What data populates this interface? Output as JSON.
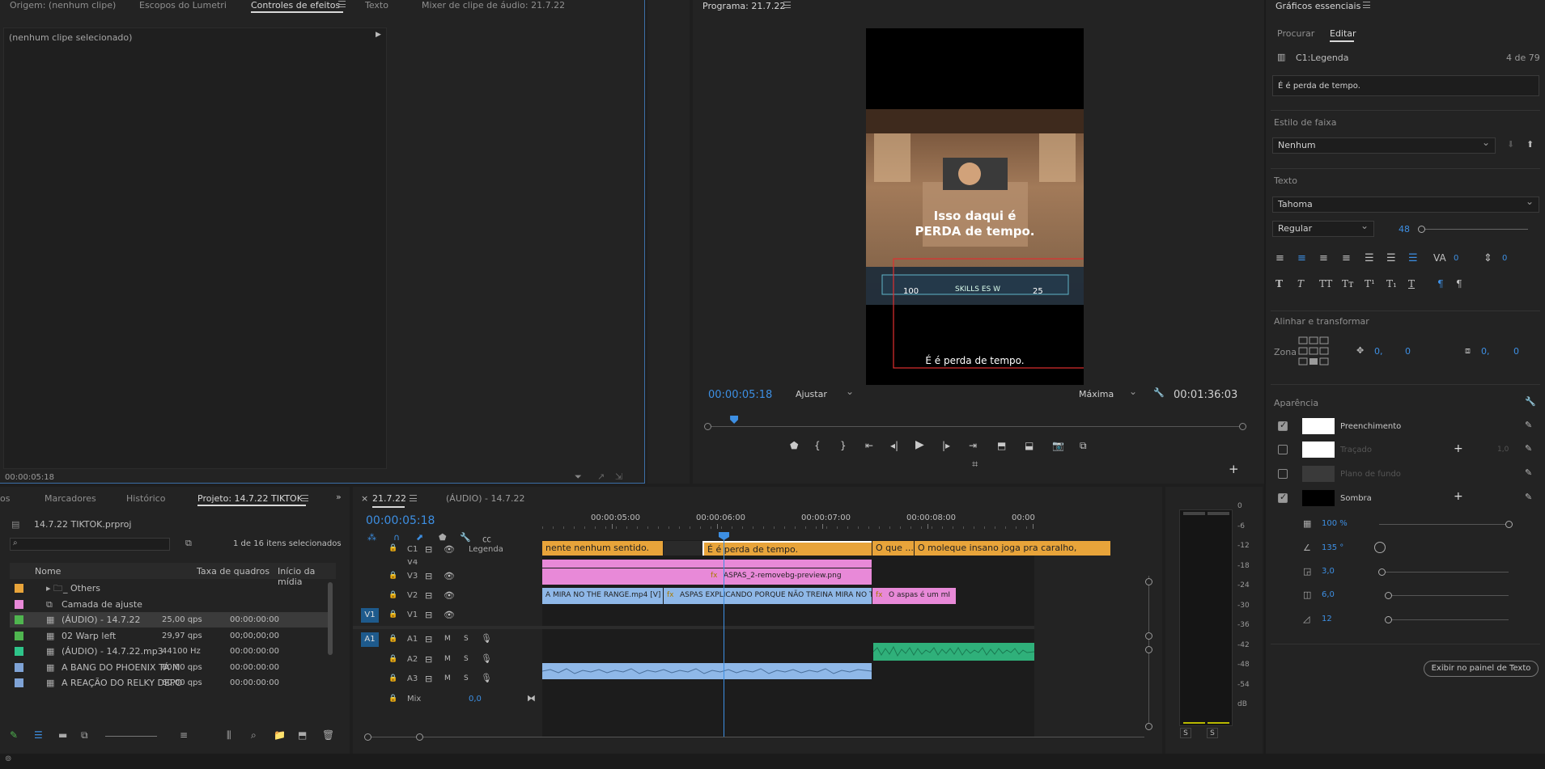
{
  "source_panel": {
    "tabs": [
      "Origem: (nenhum clipe)",
      "Escopos do Lumetri",
      "Controles de efeitos",
      "Texto",
      "Mixer de clipe de áudio: 21.7.22"
    ],
    "no_clip": "(nenhum clipe selecionado)",
    "timecode": "00:00:05:18"
  },
  "program": {
    "title": "Programa: 21.7.22",
    "timecode": "00:00:05:18",
    "fit": "Ajustar",
    "quality": "Máxima",
    "duration": "00:01:36:03",
    "frame_text_1": "Isso daqui é",
    "frame_text_2": "PERDA de tempo.",
    "caption": "É é perda de tempo.",
    "hud_left": "100",
    "hud_mid": "SKILLS ES W",
    "hud_right": "25",
    "playhead_fraction": 0.05
  },
  "project_panel": {
    "tabs": [
      "os",
      "Marcadores",
      "Histórico",
      "Projeto: 14.7.22 TIKTOK"
    ],
    "file": "14.7.22 TIKTOK.prproj",
    "count": "1 de 16 itens selecionados",
    "columns": [
      "Nome",
      "Taxa de quadros",
      "Início da mídia"
    ],
    "rows": [
      {
        "name": "_ Others",
        "rate": "",
        "start": "",
        "color": "#e8a43a"
      },
      {
        "name": "Camada de ajuste",
        "rate": "",
        "start": "",
        "color": "#e889d8"
      },
      {
        "name": "(ÁUDIO) - 14.7.22",
        "rate": "25,00 qps",
        "start": "00:00:00:00",
        "color": "#4fb54f"
      },
      {
        "name": "02 Warp left",
        "rate": "29,97 qps",
        "start": "00;00;00;00",
        "color": "#4fb54f"
      },
      {
        "name": "(ÁUDIO) - 14.7.22.mp3",
        "rate": "44100 Hz",
        "start": "00:00:00:00",
        "color": "#2ec48a"
      },
      {
        "name": "A BANG DO PHOENIX TÁ M",
        "rate": "60,00 qps",
        "start": "00:00:00:00",
        "color": "#7fa3d6"
      },
      {
        "name": "A REAÇÃO DO RELKY DEPO",
        "rate": "60,00 qps",
        "start": "00:00:00:00",
        "color": "#7fa3d6"
      }
    ]
  },
  "timeline": {
    "tabs": [
      "21.7.22",
      "(ÁUDIO) - 14.7.22"
    ],
    "timecode": "00:00:05:18",
    "ruler": [
      "00:00:05:00",
      "00:00:06:00",
      "00:00:07:00",
      "00:00:08:00",
      "00:00"
    ],
    "caption_track_label": "Legenda",
    "tracks": {
      "c1": "C1",
      "v4": "V4",
      "v3": "V3",
      "v2": "V2",
      "v1": "V1",
      "a1": "A1",
      "a2": "A2",
      "a3": "A3",
      "mix": "Mix",
      "mix_value": "0,0",
      "v1_src": "V1",
      "a1_src": "A1",
      "m": "M",
      "s": "S"
    },
    "captions": [
      "nente nenhum sentido.",
      "É é perda de tempo.",
      "O que ...",
      "O moleque insano joga pra caralho,"
    ],
    "clips": {
      "v3": "ASPAS_2-removebg-preview.png",
      "v2a": "A MIRA NO THE RANGE.mp4 [V]",
      "v2b": "ASPAS EXPLICANDO PORQUE NÃO TREINA MIRA NO TH",
      "v2c": "O aspas é um mI",
      "fx": "fx"
    }
  },
  "meter": {
    "scale": [
      "0",
      "-6",
      "-12",
      "-18",
      "-24",
      "-30",
      "-36",
      "-42",
      "-48",
      "-54",
      "dB"
    ],
    "solo": "S"
  },
  "essential_graphics": {
    "title": "Gráficos essenciais",
    "tabs": [
      "Procurar",
      "Editar"
    ],
    "layer": "C1:Legenda",
    "layer_count": "4 de 79",
    "text_value": "É é perda de tempo.",
    "track_style_label": "Estilo de faixa",
    "track_style": "Nenhum",
    "text_label": "Texto",
    "font": "Tahoma",
    "weight": "Regular",
    "size": "48",
    "tracking": "0",
    "leading": "0",
    "align_label": "Alinhar e transformar",
    "zone_label": "Zona",
    "pos_x": "0,",
    "pos_y": "0",
    "scale_x": "0,",
    "scale_y": "0",
    "appearance_label": "Aparência",
    "fill": "Preenchimento",
    "stroke": "Traçado",
    "stroke_value": "1,0",
    "bg": "Plano de fundo",
    "shadow": "Sombra",
    "opacity": "100 %",
    "angle": "135 °",
    "distance": "3,0",
    "size2": "6,0",
    "blur": "12",
    "button": "Exibir no painel de Texto"
  }
}
